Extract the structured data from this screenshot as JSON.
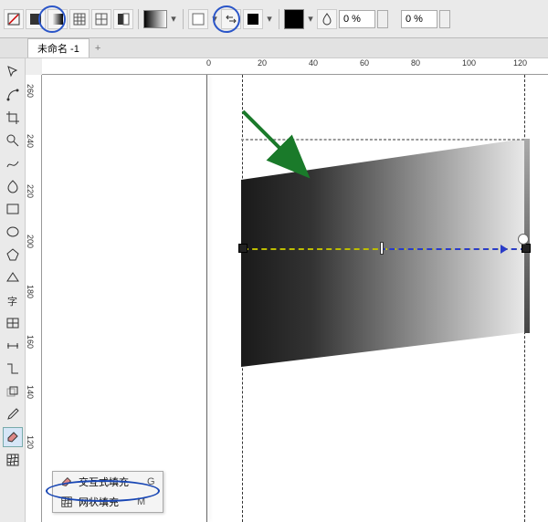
{
  "tab_title": "未命名 -1",
  "toolbar": {
    "left_value": "0 %",
    "right_value": "0 %"
  },
  "hruler_ticks": [
    "0",
    "20",
    "40",
    "60",
    "80",
    "100",
    "120"
  ],
  "vruler_ticks": [
    "260",
    "240",
    "220",
    "200",
    "180",
    "160",
    "140",
    "120"
  ],
  "popup": {
    "interactive_fill": "交互式填充",
    "interactive_fill_key": "G",
    "mesh_fill": "网状填充",
    "mesh_fill_key": "M"
  }
}
